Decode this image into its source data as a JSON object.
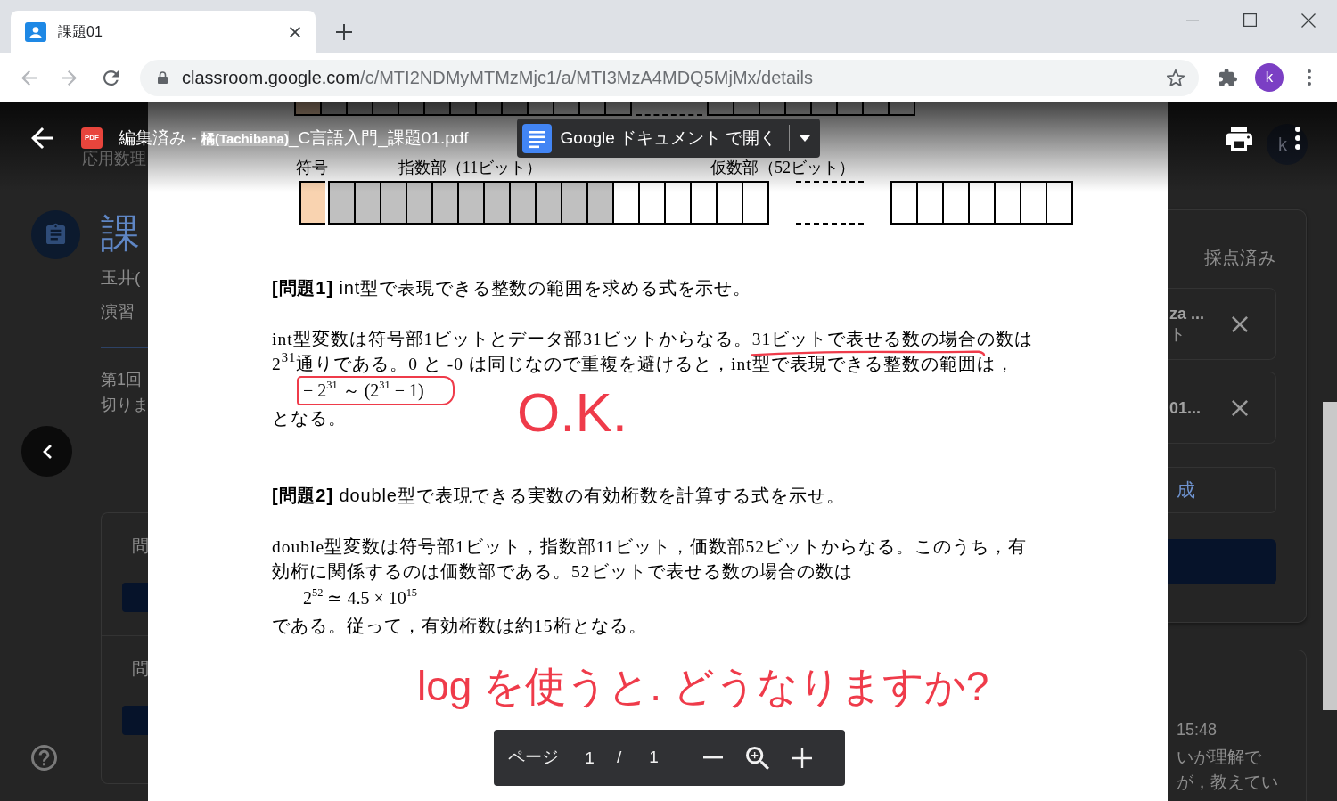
{
  "browser": {
    "tabs": [
      {
        "title": "課題01",
        "selected": true
      }
    ],
    "back": {
      "disabled": true
    },
    "forward": {
      "disabled": true
    },
    "url": {
      "host": "classroom.google.com",
      "path": "/c/MTI2NDMyMTMzMjc1/a/MTI3MzA4MDQ5MjMx/details"
    },
    "profile_initial": "k"
  },
  "background_page": {
    "left": {
      "class_subtitle": "応用数理",
      "title": "課",
      "teacher": "玉井(",
      "category": "演習",
      "description_lines": [
        "第1回",
        "切りま"
      ],
      "questions": [
        {
          "heading": "問"
        },
        {
          "heading": "問"
        }
      ]
    },
    "right": {
      "avatar_initial": "k",
      "status": "採点済み",
      "attachments": [
        {
          "title": "za ...",
          "subtitle": "ト"
        },
        {
          "title": "01..."
        }
      ],
      "create_label": "成",
      "comment": {
        "time": "15:48",
        "lines": [
          "いが理解で",
          "が，教えてい"
        ]
      }
    }
  },
  "viewer": {
    "file_badge": "PDF",
    "title": "編集済み - **橘(Tachibana)**_C言語入門_課題01.pdf",
    "open_button": "Google ドキュメント で開く",
    "page_label": "ページ",
    "page_current": "1",
    "page_separator": "/",
    "page_total": "1"
  },
  "document": {
    "bit_fields": [
      {
        "label": "符号",
        "color": "#f9d3b0"
      },
      {
        "label": "指数部（11ビット）",
        "color": "#c0c0c0"
      },
      {
        "label": "仮数部（52ビット）",
        "color": "#ffffff"
      }
    ],
    "sections": [
      {
        "kind": "question",
        "text": "**[問題1]** int型で表現できる整数の範囲を求める式を示せ。"
      },
      {
        "kind": "paragraph",
        "lines": [
          "int型変数は符号部1ビットとデータ部31ビットからなる。31ビットで表せる数の場合の数は",
          "2$^{31}$通りである。0 と -0 は同じなので重複を避けると，int型で表現できる整数の範囲は，"
        ]
      },
      {
        "kind": "formula",
        "text": "− 2$^{31}$ ～ (2$^{31}$ − 1)",
        "circled": true
      },
      {
        "kind": "paragraph",
        "lines": [
          "となる。"
        ]
      },
      {
        "kind": "question",
        "text": "**[問題2]** double型で表現できる実数の有効桁数を計算する式を示せ。"
      },
      {
        "kind": "paragraph",
        "lines": [
          "double型変数は符号部1ビット，指数部11ビット，価数部52ビットからなる。このうち，有",
          "効桁に関係するのは価数部である。52ビットで表せる数の場合の数は"
        ]
      },
      {
        "kind": "formula",
        "text": "2$^{52}$ ≃ 4.5 × 10$^{15}$",
        "circled": false
      },
      {
        "kind": "paragraph",
        "lines": [
          "である。従って，有効桁数は約15桁となる。"
        ]
      }
    ]
  },
  "annotations": [
    {
      "kind": "underline"
    },
    {
      "kind": "note",
      "text": "O.K."
    },
    {
      "kind": "note",
      "text": "log を使うと. どうなりますか?"
    }
  ]
}
